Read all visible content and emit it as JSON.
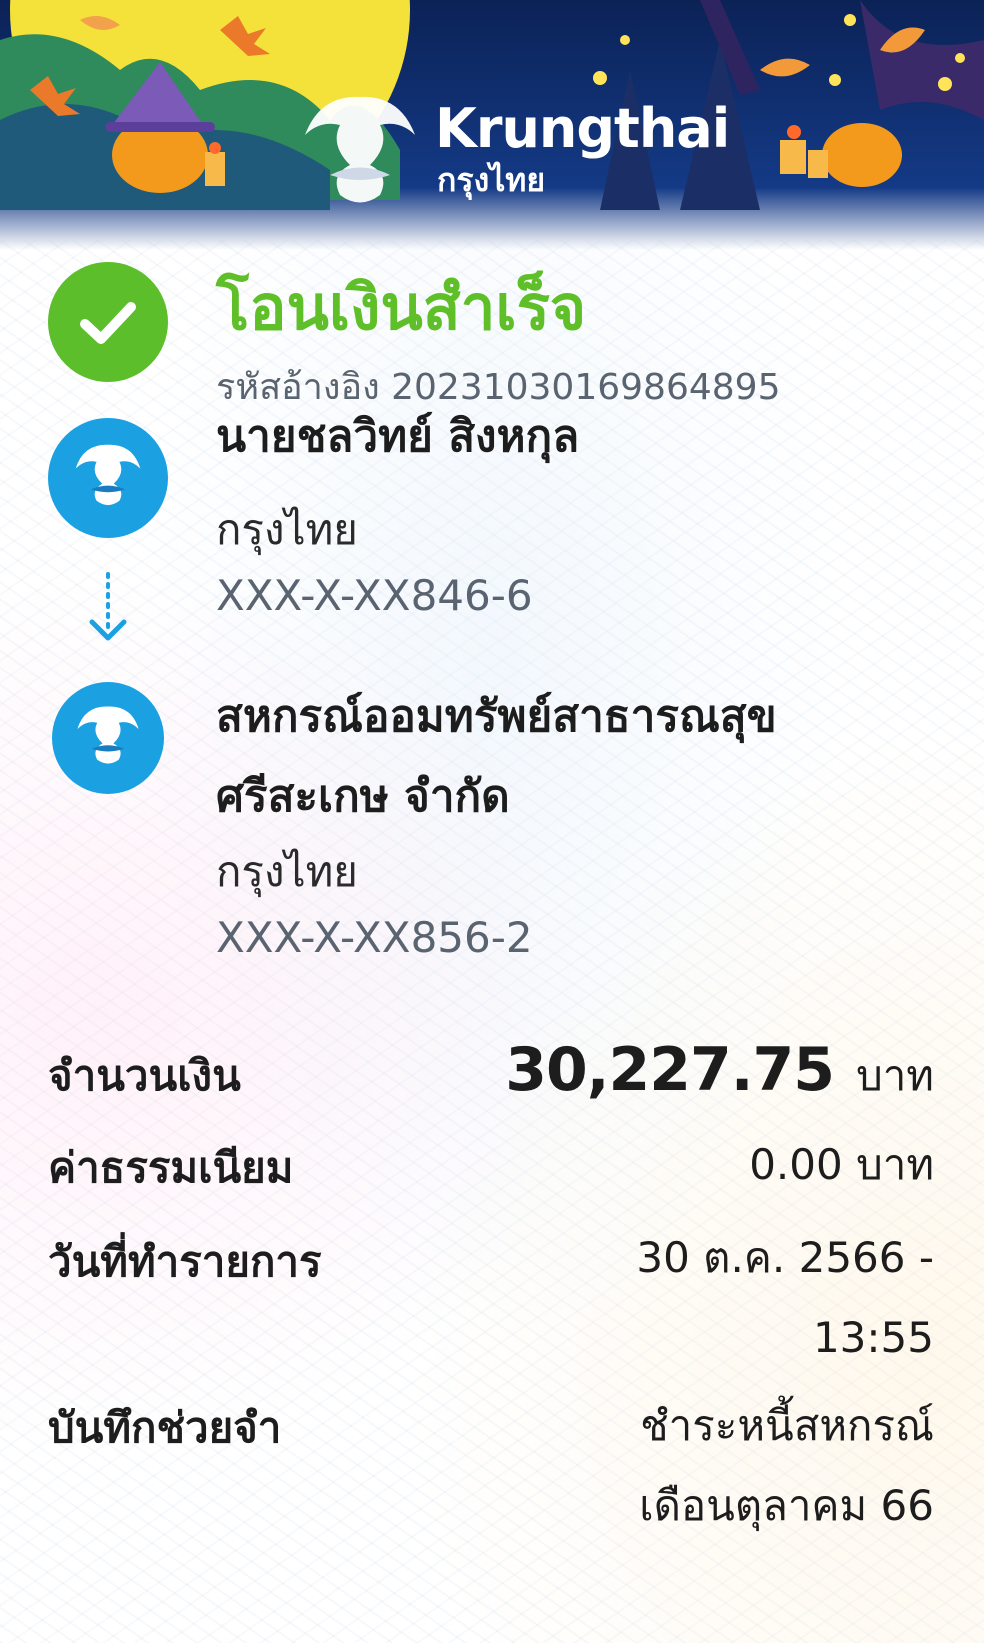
{
  "header": {
    "brand_en": "Krungthai",
    "brand_th": "กรุงไทย"
  },
  "status": {
    "title": "โอนเงินสำเร็จ",
    "reference": "รหัสอ้างอิง 20231030169864895",
    "icon": "check-icon",
    "color": "#5fbf28"
  },
  "sender": {
    "name": "นายชลวิทย์ สิงหกุล",
    "bank": "กรุงไทย",
    "account": "XXX-X-XX846-6"
  },
  "receiver": {
    "name_line1": "สหกรณ์ออมทรัพย์สาธารณสุข",
    "name_line2": "ศรีสะเกษ จำกัด",
    "bank": "กรุงไทย",
    "account": "XXX-X-XX856-2"
  },
  "details": {
    "amount_label": "จำนวนเงิน",
    "amount_value": "30,227.75",
    "amount_unit": "บาท",
    "fee_label": "ค่าธรรมเนียม",
    "fee_value": "0.00 บาท",
    "date_label": "วันที่ทำรายการ",
    "date_line1": "30 ต.ค. 2566 -",
    "date_line2": "13:55",
    "memo_label": "บันทึกช่วยจำ",
    "memo_line1": "ชำระหนี้สหกรณ์",
    "memo_line2": "เดือนตุลาคม 66"
  },
  "colors": {
    "krungthai_blue": "#1ba1e2",
    "success_green": "#5bbe2a",
    "header_navy": "#0e2a66"
  }
}
